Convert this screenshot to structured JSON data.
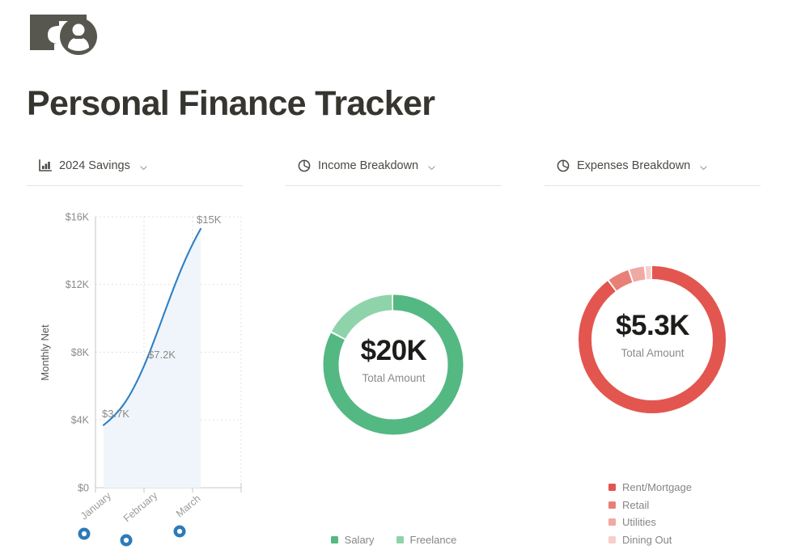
{
  "app": {
    "title": "Personal Finance Tracker",
    "logo_icon": "money-person-icon"
  },
  "panels": [
    {
      "id": "savings",
      "title": "2024 Savings",
      "icon": "bar-chart-icon",
      "chevron_icon": "chevron-down-icon"
    },
    {
      "id": "income",
      "title": "Income Breakdown",
      "icon": "pie-chart-icon",
      "chevron_icon": "chevron-down-icon"
    },
    {
      "id": "expenses",
      "title": "Expenses Breakdown",
      "icon": "pie-chart-icon",
      "chevron_icon": "chevron-down-icon"
    }
  ],
  "income_donut": {
    "total": "$20K",
    "caption": "Total Amount"
  },
  "expenses_donut": {
    "total": "$5.3K",
    "caption": "Total Amount"
  },
  "colors": {
    "line": "#2e7fc4",
    "area": "#eef4fb",
    "marker": "#2d7ab8",
    "salary": "#54b882",
    "freelance": "#8fd3ab",
    "rent": "#e2564f",
    "retail": "#e98078",
    "utilities": "#f0a9a3",
    "dining": "#f6cfcb",
    "axis_text": "#8a8a88",
    "title": "#36352f"
  },
  "chart_data": [
    {
      "type": "line",
      "title": "2024 Savings",
      "xlabel": "",
      "ylabel": "Monthly Net",
      "categories": [
        "January",
        "February",
        "March"
      ],
      "values": [
        3700,
        7200,
        15000
      ],
      "point_labels": [
        "$3.7K",
        "$7.2K",
        "$15K"
      ],
      "ytick_labels": [
        "$0",
        "$4K",
        "$8K",
        "$12K",
        "$16K"
      ],
      "ytick_values": [
        0,
        4000,
        8000,
        12000,
        16000
      ],
      "ylim": [
        0,
        16000
      ],
      "grid": true,
      "area_fill": true,
      "legend": "none",
      "markers_below_axis": true
    },
    {
      "type": "pie",
      "title": "Income Breakdown",
      "center_value": "$20K",
      "center_caption": "Total Amount",
      "donut": true,
      "legend_position": "bottom",
      "labels": [
        "Salary",
        "Freelance"
      ],
      "values": [
        16500,
        3500
      ],
      "percentages": [
        82.5,
        17.5
      ],
      "colors": [
        "#54b882",
        "#8fd3ab"
      ]
    },
    {
      "type": "pie",
      "title": "Expenses Breakdown",
      "center_value": "$5.3K",
      "center_caption": "Total Amount",
      "donut": true,
      "legend_position": "bottom-left",
      "labels": [
        "Rent/Mortgage",
        "Retail",
        "Utilities",
        "Dining Out"
      ],
      "values": [
        4770,
        265,
        185,
        80
      ],
      "percentages": [
        90.0,
        5.0,
        3.5,
        1.5
      ],
      "colors": [
        "#e2564f",
        "#e98078",
        "#f0a9a3",
        "#f6cfcb"
      ]
    }
  ],
  "savings_axis": {
    "y_label": "Monthly Net",
    "y_ticks": [
      {
        "label": "$16K"
      },
      {
        "label": "$12K"
      },
      {
        "label": "$8K"
      },
      {
        "label": "$4K"
      },
      {
        "label": "$0"
      }
    ],
    "x_ticks": [
      {
        "label": "January"
      },
      {
        "label": "February"
      },
      {
        "label": "March"
      }
    ],
    "point_labels": [
      {
        "label": "$3.7K"
      },
      {
        "label": "$7.2K"
      },
      {
        "label": "$15K"
      }
    ]
  },
  "income_legend": [
    {
      "label": "Salary",
      "color": "#54b882"
    },
    {
      "label": "Freelance",
      "color": "#8fd3ab"
    }
  ],
  "expenses_legend": [
    {
      "label": "Rent/Mortgage",
      "color": "#e2564f"
    },
    {
      "label": "Retail",
      "color": "#e98078"
    },
    {
      "label": "Utilities",
      "color": "#f0a9a3"
    },
    {
      "label": "Dining Out",
      "color": "#f6cfcb"
    }
  ]
}
